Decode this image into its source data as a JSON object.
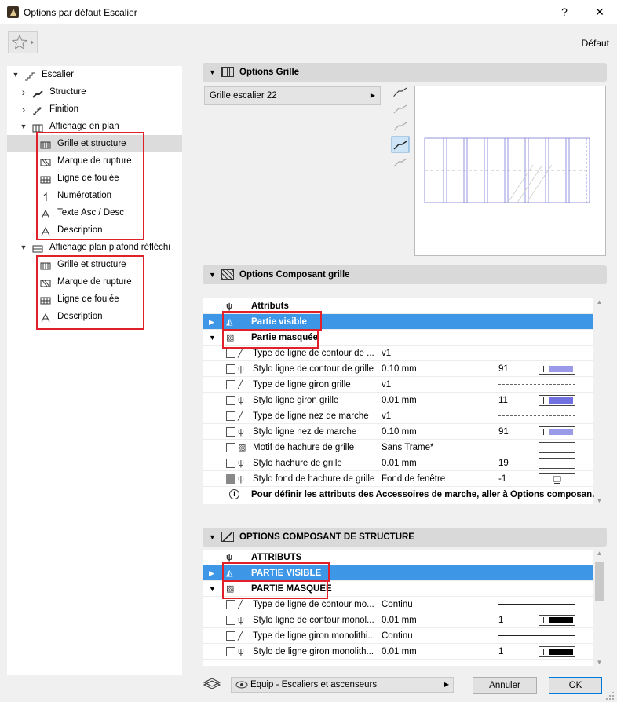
{
  "window": {
    "title": "Options par défaut Escalier",
    "help": "?",
    "close": "✕"
  },
  "toolbar": {
    "preset_label": "Défaut"
  },
  "tree": [
    {
      "label": "Escalier",
      "indent": 0,
      "arrow": "▼",
      "icon": "stair-icon"
    },
    {
      "label": "Structure",
      "indent": 1,
      "arrow": "›",
      "icon": "structure-icon"
    },
    {
      "label": "Finition",
      "indent": 1,
      "arrow": "›",
      "icon": "finish-icon"
    },
    {
      "label": "Affichage en plan",
      "indent": 1,
      "arrow": "▼",
      "icon": "floorplan-icon"
    },
    {
      "label": "Grille et structure",
      "indent": 2,
      "icon": "grid-icon",
      "selected": true
    },
    {
      "label": "Marque de rupture",
      "indent": 2,
      "icon": "break-mark-icon"
    },
    {
      "label": "Ligne de foulée",
      "indent": 2,
      "icon": "walking-line-icon"
    },
    {
      "label": "Numérotation",
      "indent": 2,
      "icon": "numbering-icon"
    },
    {
      "label": "Texte Asc / Desc",
      "indent": 2,
      "icon": "text-icon"
    },
    {
      "label": "Description",
      "indent": 2,
      "icon": "description-icon"
    },
    {
      "label": "Affichage plan plafond réfléchi",
      "indent": 1,
      "arrow": "▼",
      "icon": "ceiling-plan-icon"
    },
    {
      "label": "Grille et structure",
      "indent": 2,
      "icon": "grid-icon"
    },
    {
      "label": "Marque de rupture",
      "indent": 2,
      "icon": "break-mark-icon"
    },
    {
      "label": "Ligne de foulée",
      "indent": 2,
      "icon": "walking-line-icon"
    },
    {
      "label": "Description",
      "indent": 2,
      "icon": "description-icon"
    }
  ],
  "sections": {
    "grid_options": "Options Grille",
    "grid_component": "Options Composant grille",
    "structure_component": "OPTIONS COMPOSANT DE STRUCTURE"
  },
  "grid_select": {
    "value": "Grille escalier 22"
  },
  "grid_table": {
    "header": "Attributs",
    "visible": "Partie visible",
    "hidden": "Partie masquée",
    "rows": [
      {
        "label": "Type de ligne de contour de ...",
        "value": "v1",
        "num": "",
        "style": "dash"
      },
      {
        "label": "Stylo ligne de contour de grille",
        "value": "0.10 mm",
        "num": "91",
        "style": "swatch",
        "color": "#9a9ae8"
      },
      {
        "label": "Type de ligne giron grille",
        "value": "v1",
        "num": "",
        "style": "dash"
      },
      {
        "label": "Stylo ligne giron grille",
        "value": "0.01 mm",
        "num": "11",
        "style": "swatch",
        "color": "#7070e0"
      },
      {
        "label": "Type de ligne nez de marche",
        "value": "v1",
        "num": "",
        "style": "dash"
      },
      {
        "label": "Stylo ligne nez de marche",
        "value": "0.10 mm",
        "num": "91",
        "style": "swatch",
        "color": "#9a9ae8"
      },
      {
        "label": "Motif de hachure de grille",
        "value": "Sans Trame*",
        "num": "",
        "style": "empty"
      },
      {
        "label": "Stylo hachure de grille",
        "value": "0.01 mm",
        "num": "19",
        "style": "empty"
      },
      {
        "label": "Stylo fond de hachure de grille",
        "value": "Fond de fenêtre",
        "num": "-1",
        "style": "monitor"
      }
    ],
    "info": "Pour définir les attributs des Accessoires de marche, aller à Options composan..."
  },
  "structure_table": {
    "header": "ATTRIBUTS",
    "visible": "PARTIE VISIBLE",
    "hidden": "PARTIE MASQUEE",
    "rows": [
      {
        "label": "Type de ligne de contour mo...",
        "value": "Continu",
        "num": "",
        "style": "solid"
      },
      {
        "label": "Stylo ligne de contour monol...",
        "value": "0.01 mm",
        "num": "1",
        "style": "swatch",
        "color": "#000000"
      },
      {
        "label": "Type de ligne giron monolithi...",
        "value": "Continu",
        "num": "",
        "style": "solid"
      },
      {
        "label": "Stylo de ligne giron monolith...",
        "value": "0.01 mm",
        "num": "1",
        "style": "swatch",
        "color": "#000000"
      }
    ]
  },
  "footer": {
    "layer": "Equip - Escaliers et ascenseurs",
    "cancel": "Annuler",
    "ok": "OK"
  },
  "colors": {
    "selection_blue": "#3d97e6",
    "highlight_red": "#e0202a"
  }
}
